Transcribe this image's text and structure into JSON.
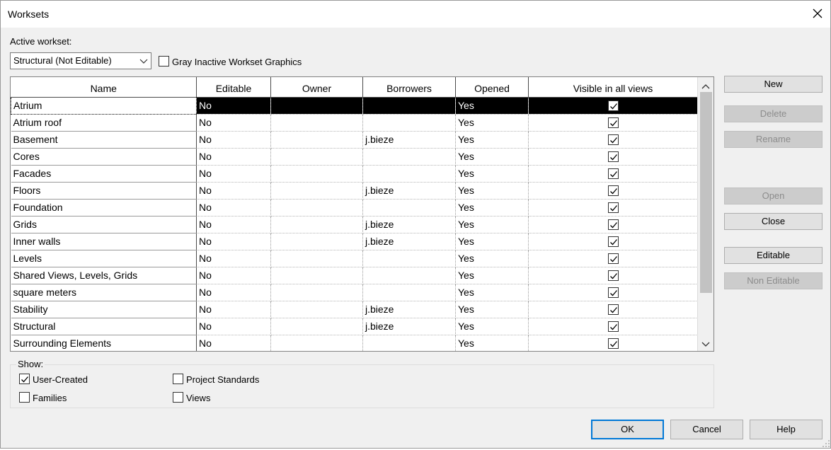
{
  "window": {
    "title": "Worksets"
  },
  "active_workset": {
    "label": "Active workset:",
    "selected": "Structural (Not Editable)",
    "gray_inactive_label": "Gray Inactive Workset Graphics",
    "gray_inactive_checked": false
  },
  "table": {
    "columns": [
      "Name",
      "Editable",
      "Owner",
      "Borrowers",
      "Opened",
      "Visible in all views"
    ],
    "rows": [
      {
        "name": "Atrium",
        "editable": "No",
        "owner": "",
        "borrowers": "",
        "opened": "Yes",
        "visible": true
      },
      {
        "name": "Atrium roof",
        "editable": "No",
        "owner": "",
        "borrowers": "",
        "opened": "Yes",
        "visible": true
      },
      {
        "name": "Basement",
        "editable": "No",
        "owner": "",
        "borrowers": "j.bieze",
        "opened": "Yes",
        "visible": true
      },
      {
        "name": "Cores",
        "editable": "No",
        "owner": "",
        "borrowers": "",
        "opened": "Yes",
        "visible": true
      },
      {
        "name": "Facades",
        "editable": "No",
        "owner": "",
        "borrowers": "",
        "opened": "Yes",
        "visible": true
      },
      {
        "name": "Floors",
        "editable": "No",
        "owner": "",
        "borrowers": "j.bieze",
        "opened": "Yes",
        "visible": true
      },
      {
        "name": "Foundation",
        "editable": "No",
        "owner": "",
        "borrowers": "",
        "opened": "Yes",
        "visible": true
      },
      {
        "name": "Grids",
        "editable": "No",
        "owner": "",
        "borrowers": "j.bieze",
        "opened": "Yes",
        "visible": true
      },
      {
        "name": "Inner walls",
        "editable": "No",
        "owner": "",
        "borrowers": "j.bieze",
        "opened": "Yes",
        "visible": true
      },
      {
        "name": "Levels",
        "editable": "No",
        "owner": "",
        "borrowers": "",
        "opened": "Yes",
        "visible": true
      },
      {
        "name": "Shared Views, Levels, Grids",
        "editable": "No",
        "owner": "",
        "borrowers": "",
        "opened": "Yes",
        "visible": true
      },
      {
        "name": "square meters",
        "editable": "No",
        "owner": "",
        "borrowers": "",
        "opened": "Yes",
        "visible": true
      },
      {
        "name": "Stability",
        "editable": "No",
        "owner": "",
        "borrowers": "j.bieze",
        "opened": "Yes",
        "visible": true
      },
      {
        "name": "Structural",
        "editable": "No",
        "owner": "",
        "borrowers": "j.bieze",
        "opened": "Yes",
        "visible": true
      },
      {
        "name": "Surrounding Elements",
        "editable": "No",
        "owner": "",
        "borrowers": "",
        "opened": "Yes",
        "visible": true
      }
    ]
  },
  "side_buttons": {
    "new": "New",
    "delete": "Delete",
    "rename": "Rename",
    "open": "Open",
    "close": "Close",
    "editable": "Editable",
    "non_editable": "Non Editable"
  },
  "show": {
    "label": "Show:",
    "user_created": {
      "label": "User-Created",
      "checked": true
    },
    "families": {
      "label": "Families",
      "checked": false
    },
    "project_standards": {
      "label": "Project Standards",
      "checked": false
    },
    "views": {
      "label": "Views",
      "checked": false
    }
  },
  "footer": {
    "ok": "OK",
    "cancel": "Cancel",
    "help": "Help"
  },
  "colors": {
    "selection": "#000000",
    "focus_border": "#0078d7",
    "dialog_bg": "#f0f0f0"
  },
  "icons": [
    "close-icon",
    "chevron-down-icon",
    "checkmark-icon",
    "scroll-up-icon",
    "scroll-down-icon",
    "resize-grip-icon"
  ]
}
